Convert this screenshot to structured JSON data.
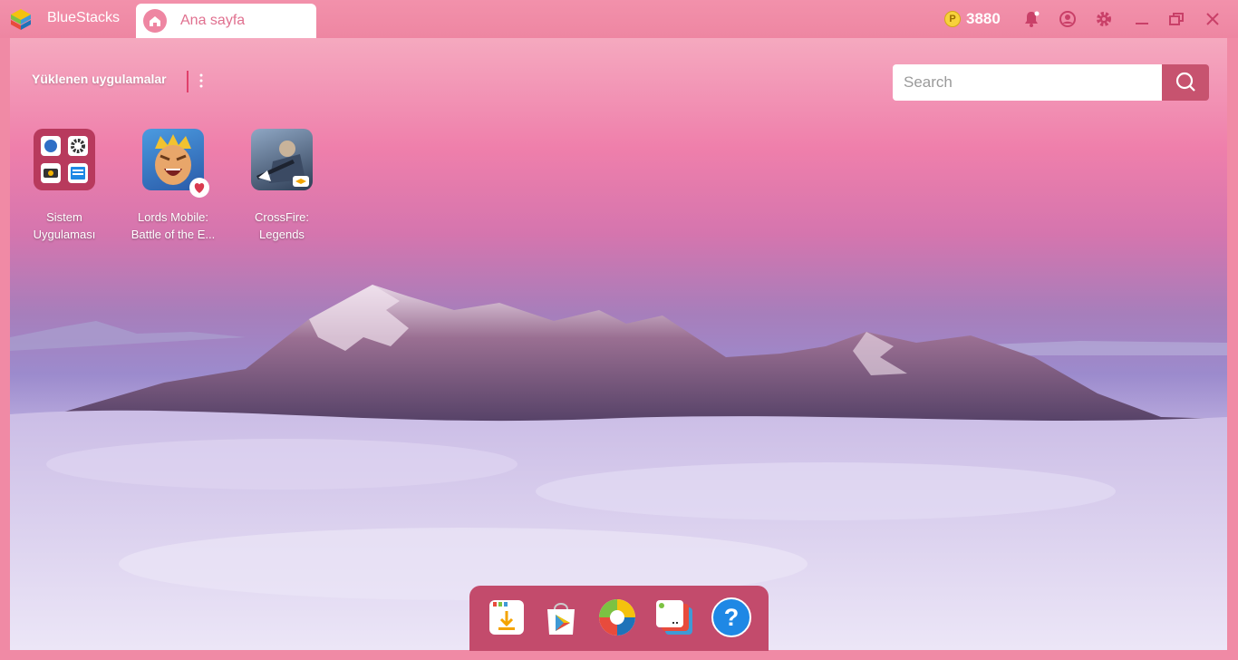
{
  "titlebar": {
    "app_name": "BlueStacks",
    "tab_label": "Ana sayfa",
    "coin_symbol": "P",
    "coin_count": "3880",
    "icons": [
      "notification-bell-icon",
      "user-account-icon",
      "settings-gear-icon",
      "minimize-icon",
      "restore-icon",
      "close-icon"
    ]
  },
  "home": {
    "installed_header": "Yüklenen uygulamalar",
    "search": {
      "placeholder": "Search",
      "value": ""
    },
    "apps": [
      {
        "label_line1": "Sistem",
        "label_line2": "Uygulaması",
        "icon": "system-apps-folder-icon"
      },
      {
        "label_line1": "Lords Mobile:",
        "label_line2": "Battle of the E...",
        "icon": "lords-mobile-icon",
        "badge": "heart-favorite-icon"
      },
      {
        "label_line1": "CrossFire:",
        "label_line2": "Legends",
        "icon": "crossfire-legends-icon"
      }
    ]
  },
  "dock": {
    "items": [
      "app-installer-icon",
      "play-store-icon",
      "browser-globe-icon",
      "multi-instance-icon",
      "help-icon"
    ],
    "help_symbol": "?"
  },
  "colors": {
    "titlebar": "#ee86a2",
    "tab_text": "#e0708f",
    "search_button": "#c7536f",
    "dock": "#c34b6c",
    "coin": "#f7d23c"
  }
}
